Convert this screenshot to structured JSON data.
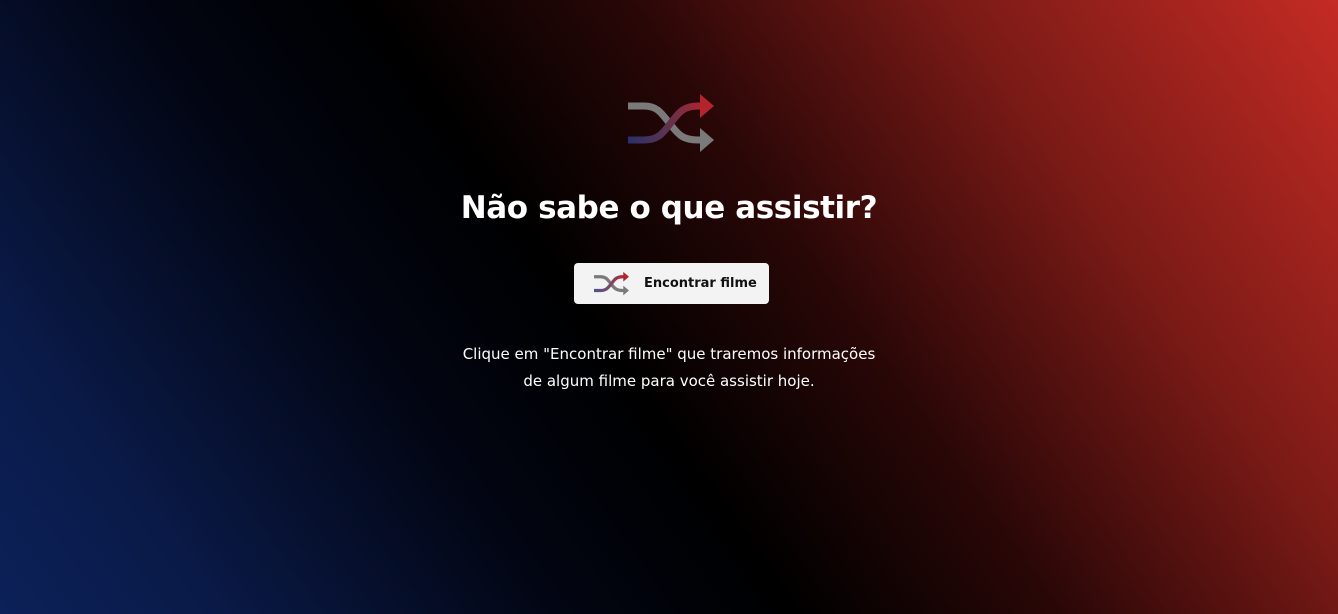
{
  "hero": {
    "icon": "shuffle-icon",
    "title": "Não sabe o que assistir?",
    "button": {
      "label": "Encontrar filme",
      "icon": "shuffle-icon"
    },
    "description_lines": [
      "Clique em \"Encontrar filme\" que traremos informações",
      "de algum filme para você assistir hoje."
    ]
  },
  "colors": {
    "accent_red": "#c42b24",
    "accent_blue": "#0c2159",
    "icon_gray": "#7a7a7a",
    "icon_red": "#b3242c",
    "icon_navy": "#28306a",
    "button_bg": "#f3f3f4",
    "button_text": "#111111"
  }
}
